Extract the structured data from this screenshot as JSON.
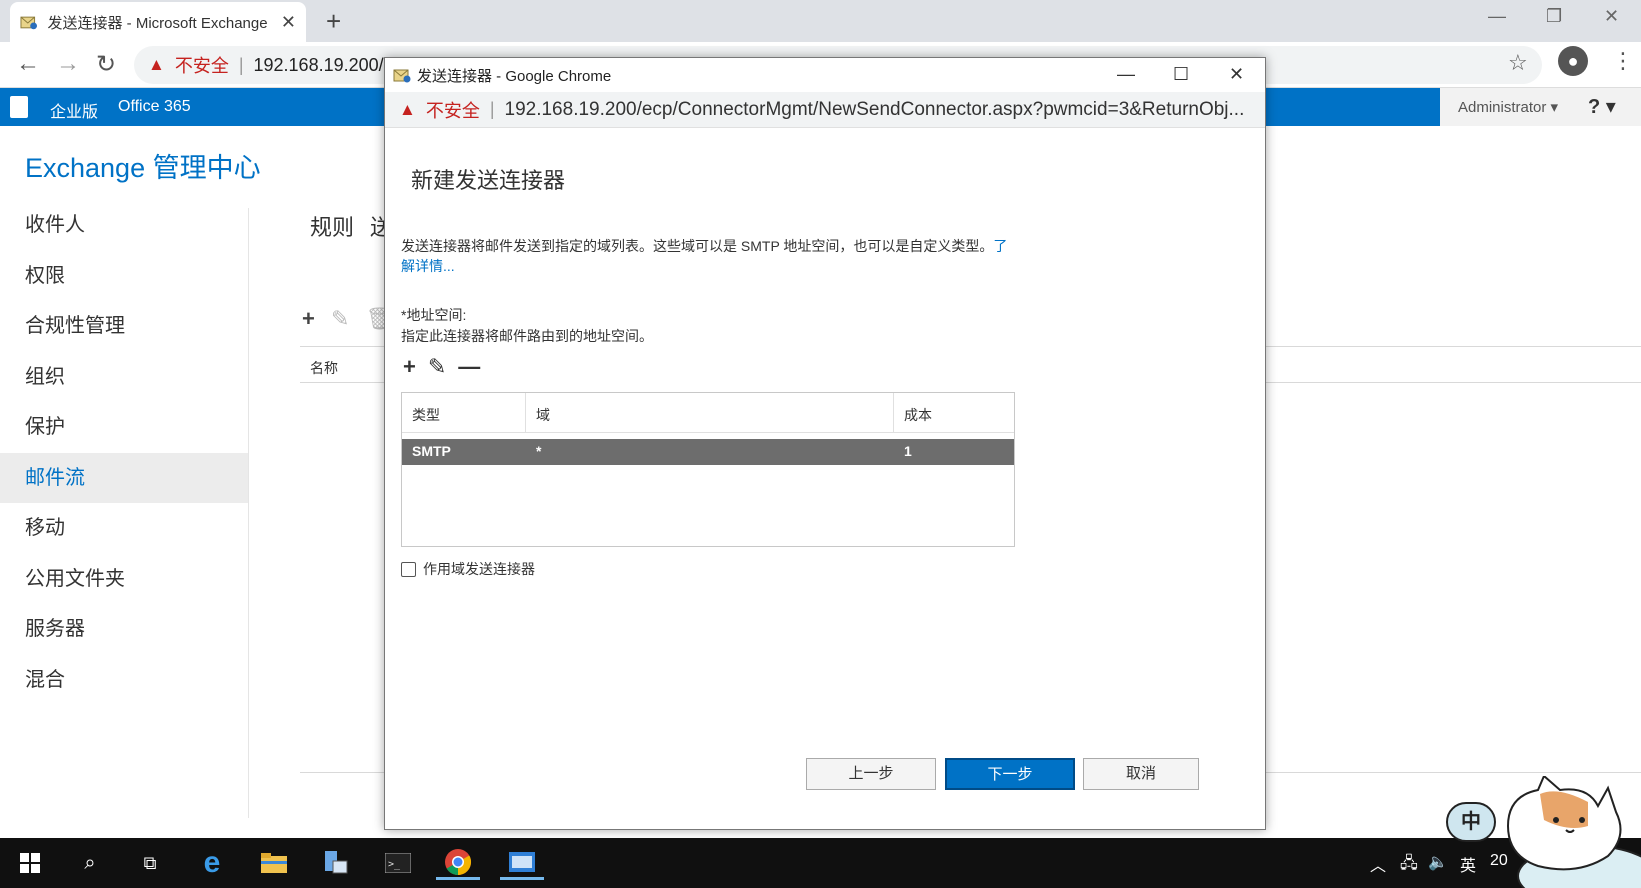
{
  "browser": {
    "tab_title": "发送连接器 - Microsoft Exchange",
    "new_tab": "+",
    "not_secure": "不安全",
    "url_main": "192.168.19.200/"
  },
  "exchange_bar": {
    "enterprise": "企业版",
    "office365": "Office 365",
    "admin": "Administrator ▾",
    "help": "? ▾"
  },
  "page": {
    "title": "Exchange 管理中心",
    "nav": [
      "收件人",
      "权限",
      "合规性管理",
      "组织",
      "保护",
      "邮件流",
      "移动",
      "公用文件夹",
      "服务器",
      "混合"
    ],
    "active_nav": "邮件流",
    "tab_rules": "规则",
    "tab_cut": "送",
    "col_name": "名称"
  },
  "popup": {
    "window_title": "发送连接器 - Google Chrome",
    "not_secure": "不安全",
    "url": "192.168.19.200/ecp/ConnectorMgmt/NewSendConnector.aspx?pwmcid=3&ReturnObj...",
    "heading": "新建发送连接器",
    "description": "发送连接器将邮件发送到指定的域列表。这些域可以是 SMTP 地址空间，也可以是自定义类型。",
    "learn_more": "了解详情...",
    "address_label": "*地址空间:",
    "address_hint": "指定此连接器将邮件路由到的地址空间。",
    "grid": {
      "headers": [
        "类型",
        "域",
        "成本"
      ],
      "rows": [
        {
          "type": "SMTP",
          "domain": "*",
          "cost": "1"
        }
      ]
    },
    "scoped_checkbox": "作用域发送连接器",
    "buttons": {
      "back": "上一步",
      "next": "下一步",
      "cancel": "取消"
    }
  },
  "taskbar": {
    "ime_cn": "中",
    "ime_lang": "英",
    "clock_partial": "20"
  },
  "colors": {
    "exchange_blue": "#0072c6",
    "selected_row": "#6d6d6d",
    "warning_red": "#c5221f",
    "taskbar": "#101010"
  }
}
